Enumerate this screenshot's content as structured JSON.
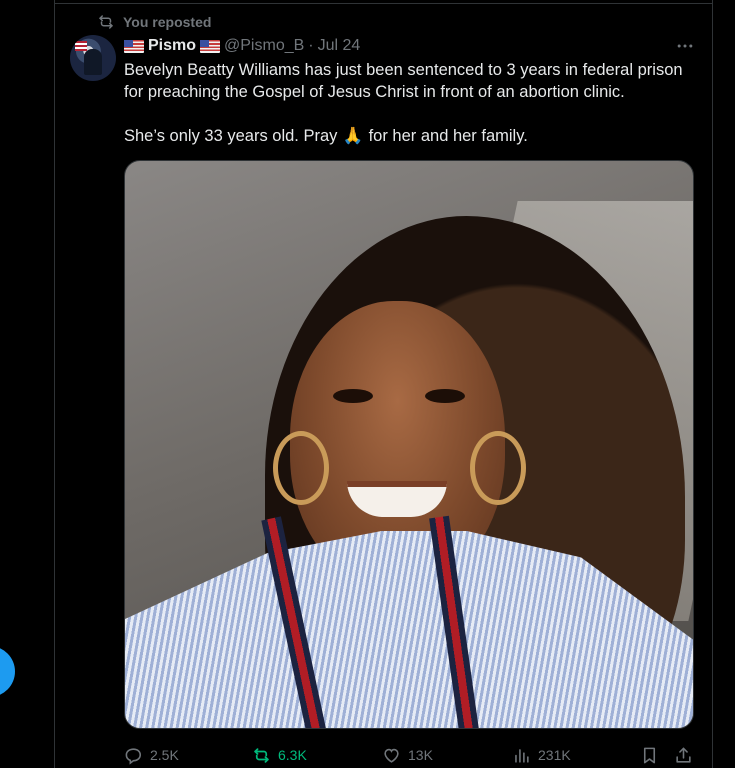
{
  "repost_label": "You reposted",
  "author": {
    "name": "Pismo",
    "handle": "@Pismo_B",
    "separator": "·",
    "date": "Jul 24"
  },
  "tweet": {
    "line1": "Bevelyn Beatty Williams has just been sentenced to 3 years in federal prison for preaching the Gospel of Jesus Christ in front of an abortion clinic.",
    "line2_before": "She’s only 33 years old.  Pray ",
    "line2_emoji": "🙏",
    "line2_after": " for her and her family."
  },
  "stats": {
    "replies": "2.5K",
    "reposts": "6.3K",
    "likes": "13K",
    "views": "231K"
  },
  "colors": {
    "background": "#000000",
    "text": "#e7e9ea",
    "muted": "#71767b",
    "repost_active": "#00ba7c",
    "accent": "#1d9bf0"
  },
  "icons": [
    "repost-icon",
    "more-icon",
    "reply-icon",
    "like-icon",
    "views-icon",
    "bookmark-icon",
    "share-icon",
    "flag-us-icon"
  ]
}
